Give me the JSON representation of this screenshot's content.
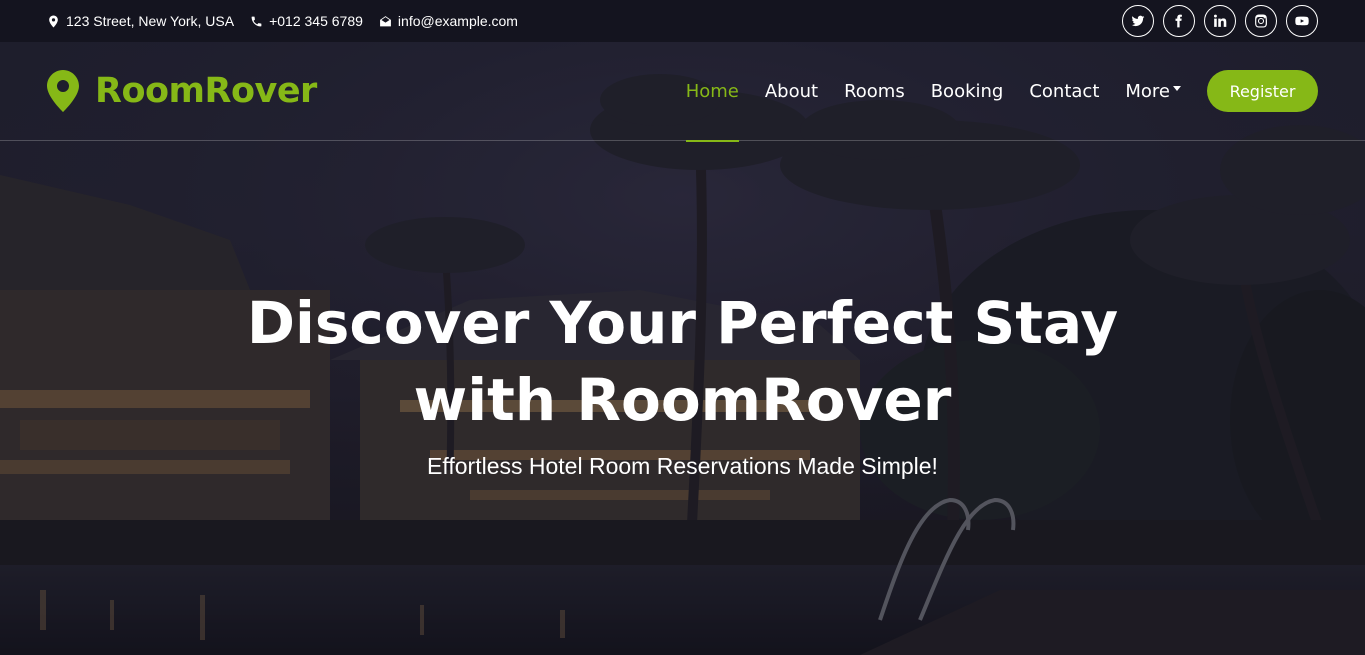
{
  "topbar": {
    "address": "123 Street, New York, USA",
    "phone": "+012 345 6789",
    "email": "info@example.com",
    "socials": [
      "twitter",
      "facebook",
      "linkedin",
      "instagram",
      "youtube"
    ]
  },
  "brand": {
    "name": "RoomRover",
    "icon": "map-pin-icon",
    "color": "#86b817"
  },
  "nav": {
    "items": [
      {
        "label": "Home",
        "active": true
      },
      {
        "label": "About",
        "active": false
      },
      {
        "label": "Rooms",
        "active": false
      },
      {
        "label": "Booking",
        "active": false
      },
      {
        "label": "Contact",
        "active": false
      },
      {
        "label": "More",
        "active": false,
        "dropdown": true
      }
    ],
    "register_label": "Register"
  },
  "hero": {
    "title_line1": "Discover Your Perfect Stay",
    "title_line2": "with RoomRover",
    "subtitle": "Effortless Hotel Room Reservations Made Simple!"
  },
  "colors": {
    "accent": "#86b817",
    "topbar_bg": "#14141f",
    "text": "#ffffff"
  }
}
